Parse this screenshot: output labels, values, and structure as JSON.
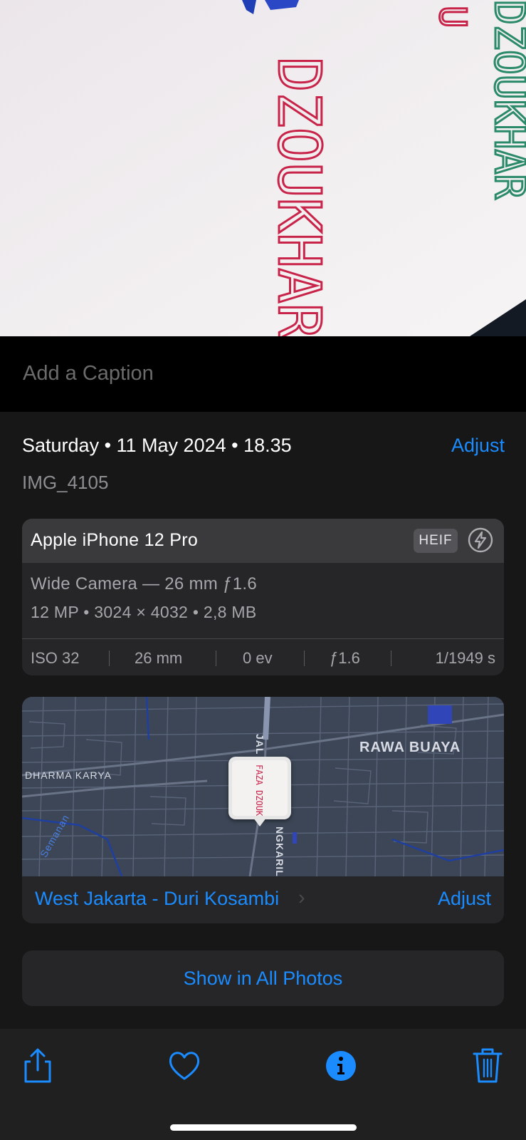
{
  "photo": {
    "handwriting_left": "DZOUKHAR",
    "handwriting_right": "DZOUKHAR",
    "handwriting_top": "U"
  },
  "caption": {
    "placeholder": "Add a Caption"
  },
  "info": {
    "date": "Saturday • 11 May 2024 • 18.35",
    "adjust_label": "Adjust",
    "filename": "IMG_4105"
  },
  "camera": {
    "device": "Apple iPhone 12 Pro",
    "format_badge": "HEIF",
    "flash_icon": "flash-off-icon",
    "lens": "Wide Camera — 26 mm ƒ1.6",
    "specs": "12 MP  •  3024 × 4032  •  2,8 MB",
    "exif": {
      "iso": "ISO 32",
      "focal": "26 mm",
      "ev": "0 ev",
      "aperture": "ƒ1.6",
      "shutter": "1/1949 s"
    }
  },
  "map": {
    "labels": {
      "rawa_buaya": "RAWA BUAYA",
      "dharma_karya": "DHARMA KARYA",
      "road_top": "JAL",
      "road_bottom": "NGKARIL",
      "canal": "Semanan"
    },
    "pin_thumb_text": "FAZA DZOUKHAR",
    "location": "West Jakarta - Duri Kosambi",
    "adjust_label": "Adjust"
  },
  "show_all_label": "Show in All Photos",
  "toolbar": {
    "share_icon": "share-icon",
    "favorite_icon": "heart-icon",
    "info_icon": "info-icon",
    "delete_icon": "trash-icon"
  },
  "colors": {
    "accent": "#1a8cff",
    "background": "#171717",
    "card": "#262628",
    "map": "#3c4656"
  }
}
